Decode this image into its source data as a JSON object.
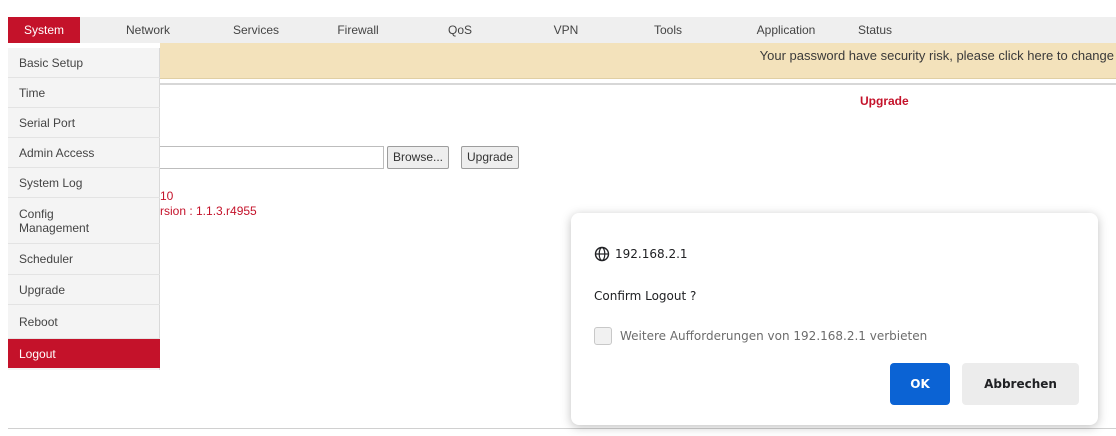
{
  "nav": {
    "items": [
      {
        "label": "System",
        "active": true
      },
      {
        "label": "Network"
      },
      {
        "label": "Services"
      },
      {
        "label": "Firewall"
      },
      {
        "label": "QoS"
      },
      {
        "label": "VPN"
      },
      {
        "label": "Tools"
      },
      {
        "label": "Application"
      },
      {
        "label": "Status"
      }
    ]
  },
  "banner": {
    "text": "Your password have security risk, please click here to change"
  },
  "page": {
    "section_title": "Upgrade",
    "browse_label": "Browse...",
    "upgrade_label": "Upgrade",
    "info_line1": "10",
    "info_line2": "rsion : 1.1.3.r4955"
  },
  "sidebar": {
    "items": [
      {
        "label": "Basic Setup"
      },
      {
        "label": "Time"
      },
      {
        "label": "Serial Port"
      },
      {
        "label": "Admin Access"
      },
      {
        "label": "System Log"
      },
      {
        "label": "Config Management"
      },
      {
        "label": "Scheduler"
      },
      {
        "label": "Upgrade"
      },
      {
        "label": "Reboot"
      },
      {
        "label": "Logout",
        "active": true
      }
    ]
  },
  "dialog": {
    "origin": "192.168.2.1",
    "message": "Confirm Logout ?",
    "checkbox_label": "Weitere Aufforderungen von 192.168.2.1 verbieten",
    "ok_label": "OK",
    "cancel_label": "Abbrechen"
  },
  "colors": {
    "brand_red": "#c4122a",
    "banner_bg": "#f3e2bb",
    "ok_blue": "#0b63d4"
  }
}
